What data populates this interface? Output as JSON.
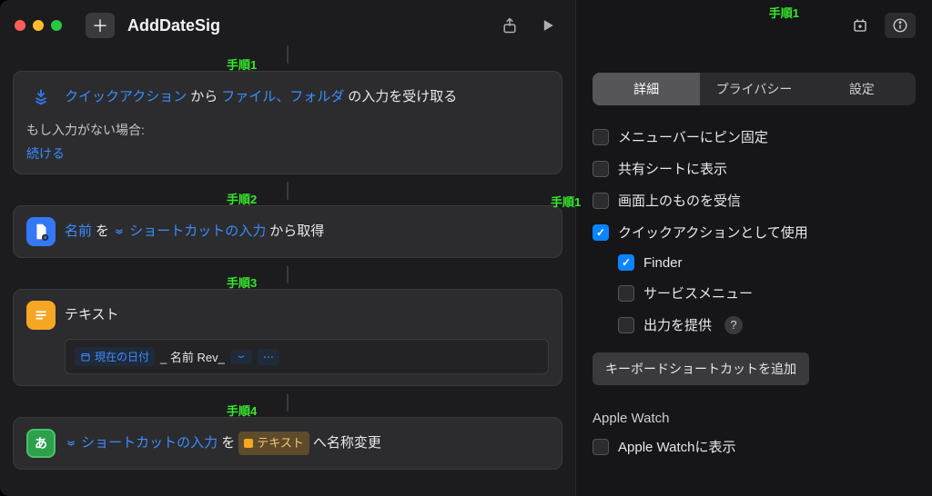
{
  "titlebar": {
    "title": "AddDateSig"
  },
  "steps": {
    "s1": "手順1",
    "s2": "手順2",
    "s3": "手順3",
    "s4": "手順4"
  },
  "card1": {
    "tok_quick_action": "クイックアクション",
    "tok_from": "から",
    "tok_files_folders": "ファイル、フォルダ",
    "tok_receive_input": "の入力を受け取る",
    "no_input_label": "もし入力がない場合:",
    "continue_label": "続ける"
  },
  "card2": {
    "tok_name": "名前",
    "tok_wo": "を",
    "tok_shortcut_input": "ショートカットの入力",
    "tok_get_from": "から取得"
  },
  "card3": {
    "title": "テキスト",
    "var_current_date": "現在の日付",
    "literal_mid": "_ 名前 Rev_",
    "var_trailing_icon": true
  },
  "card4": {
    "tok_shortcut_input": "ショートカットの入力",
    "tok_wo": "を",
    "tok_text": "テキスト",
    "tok_rename": "へ名称変更"
  },
  "inspector": {
    "step1": "手順1",
    "tabs": {
      "details": "詳細",
      "privacy": "プライバシー",
      "settings": "設定"
    },
    "rows": {
      "pin_menubar": "メニューバーにピン固定",
      "share_sheet": "共有シートに表示",
      "receive_onscreen": "画面上のものを受信",
      "use_as_quick_action": "クイックアクションとして使用",
      "finder": "Finder",
      "services_menu": "サービスメニュー",
      "provide_output": "出力を提供"
    },
    "kbd_button": "キーボードショートカットを追加",
    "apple_watch_heading": "Apple Watch",
    "apple_watch_row": "Apple Watchに表示"
  }
}
